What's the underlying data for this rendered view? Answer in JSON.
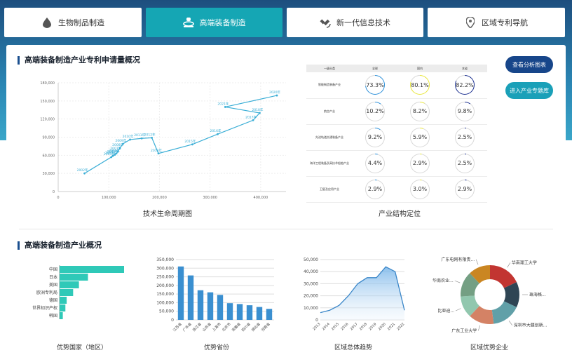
{
  "tabs": [
    {
      "label": "生物制品制造",
      "icon": "drop-icon",
      "active": false
    },
    {
      "label": "高端装备制造",
      "icon": "machine-icon",
      "active": true
    },
    {
      "label": "新一代信息技术",
      "icon": "satellite-icon",
      "active": false
    },
    {
      "label": "区域专利导航",
      "icon": "location-pin-icon",
      "active": false
    }
  ],
  "section1": {
    "title": "高端装备制造产业专利申请量概况"
  },
  "section2": {
    "title": "高端装备制造产业概况"
  },
  "buttons": {
    "analysis": "查看分析图表",
    "database": "进入产业专题库"
  },
  "colors": {
    "accent": "#15a6b4",
    "navy": "#1a4f8f",
    "line": "#3aaed6",
    "bar_green": "#2fc9b8",
    "bar_blue": "#3a8fd0"
  },
  "lifecycle": {
    "caption": "技术生命周期图",
    "chart_data": {
      "type": "line",
      "title": "",
      "xlim": [
        0,
        450000
      ],
      "ylim": [
        0,
        180000
      ],
      "x_ticks": [
        "0",
        "100,000",
        "200,000",
        "300,000",
        "400,000"
      ],
      "y_ticks": [
        "0",
        "30,000",
        "60,000",
        "90,000",
        "120,000",
        "150,000",
        "180,000"
      ],
      "points": [
        {
          "label": "2002年",
          "x": 52000,
          "y": 30000
        },
        {
          "label": "2003年",
          "x": 105000,
          "y": 57000
        },
        {
          "label": "2004年",
          "x": 108000,
          "y": 59000
        },
        {
          "label": "2005年",
          "x": 112000,
          "y": 61000
        },
        {
          "label": "2006年",
          "x": 115000,
          "y": 63000
        },
        {
          "label": "2007年",
          "x": 118000,
          "y": 66000
        },
        {
          "label": "2008年",
          "x": 122000,
          "y": 72000
        },
        {
          "label": "2009年",
          "x": 128000,
          "y": 79000
        },
        {
          "label": "2010年",
          "x": 142000,
          "y": 86000
        },
        {
          "label": "2011年",
          "x": 165000,
          "y": 88000
        },
        {
          "label": "2012年",
          "x": 185000,
          "y": 89000
        },
        {
          "label": "2013年",
          "x": 198000,
          "y": 63000
        },
        {
          "label": "2015年",
          "x": 265000,
          "y": 78000
        },
        {
          "label": "2016年",
          "x": 315000,
          "y": 95000
        },
        {
          "label": "2017年",
          "x": 385000,
          "y": 118000
        },
        {
          "label": "2018年",
          "x": 398000,
          "y": 130000
        },
        {
          "label": "2021年",
          "x": 330000,
          "y": 140000
        },
        {
          "label": "2020年",
          "x": 432000,
          "y": 159000
        }
      ]
    }
  },
  "structure": {
    "caption": "产业结构定位",
    "headers": [
      "一级分类",
      "全球",
      "国内",
      "本省"
    ],
    "rows": [
      {
        "name": "智能制造装备产业",
        "values": [
          "73.3%",
          "80.1%",
          "82.2%"
        ],
        "fractions": [
          0.733,
          0.801,
          0.822
        ]
      },
      {
        "name": "航空产业",
        "values": [
          "10.2%",
          "8.2%",
          "9.8%"
        ],
        "fractions": [
          0.102,
          0.082,
          0.098
        ]
      },
      {
        "name": "先进轨道交通装备产业",
        "values": [
          "9.2%",
          "5.9%",
          "2.5%"
        ],
        "fractions": [
          0.092,
          0.059,
          0.025
        ]
      },
      {
        "name": "海洋工程装备及高技术船舶产业",
        "values": [
          "4.4%",
          "2.9%",
          "2.5%"
        ],
        "fractions": [
          0.044,
          0.029,
          0.025
        ]
      },
      {
        "name": "卫星及应用产业",
        "values": [
          "2.9%",
          "3.0%",
          "2.9%"
        ],
        "fractions": [
          0.029,
          0.03,
          0.029
        ]
      }
    ],
    "ring_colors": [
      "#2b8fd9",
      "#e8e63a",
      "#1a2f8f"
    ]
  },
  "countries": {
    "caption": "优势国家（地区）",
    "chart_data": {
      "type": "bar",
      "orientation": "horizontal",
      "categories": [
        "中国",
        "日本",
        "美国",
        "欧洲专利局",
        "德国",
        "世界知识产权",
        "韩国"
      ],
      "values": [
        100,
        44,
        30,
        21,
        11,
        9,
        5
      ]
    }
  },
  "provinces": {
    "caption": "优势省份",
    "chart_data": {
      "type": "bar",
      "categories": [
        "江苏省",
        "广东省",
        "浙江省",
        "山东省",
        "上海市",
        "北京市",
        "安徽省",
        "四川省",
        "湖北省",
        "河南省"
      ],
      "values": [
        310000,
        258000,
        172000,
        160000,
        145000,
        97000,
        92000,
        85000,
        75000,
        64000
      ],
      "ylim": [
        0,
        350000
      ],
      "y_ticks": [
        "0",
        "50,000",
        "100,000",
        "150,000",
        "200,000",
        "250,000",
        "300,000",
        "350,000"
      ]
    }
  },
  "trend": {
    "caption": "区域总体趋势",
    "chart_data": {
      "type": "area",
      "x": [
        "2013",
        "2014",
        "2015",
        "2016",
        "2017",
        "2018",
        "2019",
        "2020",
        "2021",
        "2022"
      ],
      "values": [
        6000,
        8000,
        12000,
        20000,
        30000,
        35000,
        35000,
        44000,
        40000,
        8000
      ],
      "ylim": [
        0,
        50000
      ],
      "y_ticks": [
        "0",
        "10,000",
        "20,000",
        "30,000",
        "40,000",
        "50,000"
      ]
    }
  },
  "companies": {
    "caption": "区域优势企业",
    "chart_data": {
      "type": "pie",
      "donut": true,
      "labels": [
        "华南理工大学",
        "珠海格...",
        "深圳市大疆创新...",
        "广东工业大学",
        "比亚迪...",
        "华南农业...",
        "广东电网有限责..."
      ],
      "values": [
        18,
        14,
        16,
        14,
        12,
        14,
        12
      ],
      "colors": [
        "#c23531",
        "#2f4554",
        "#61a0a8",
        "#d48265",
        "#91c7ae",
        "#749f83",
        "#ca8622"
      ]
    }
  }
}
